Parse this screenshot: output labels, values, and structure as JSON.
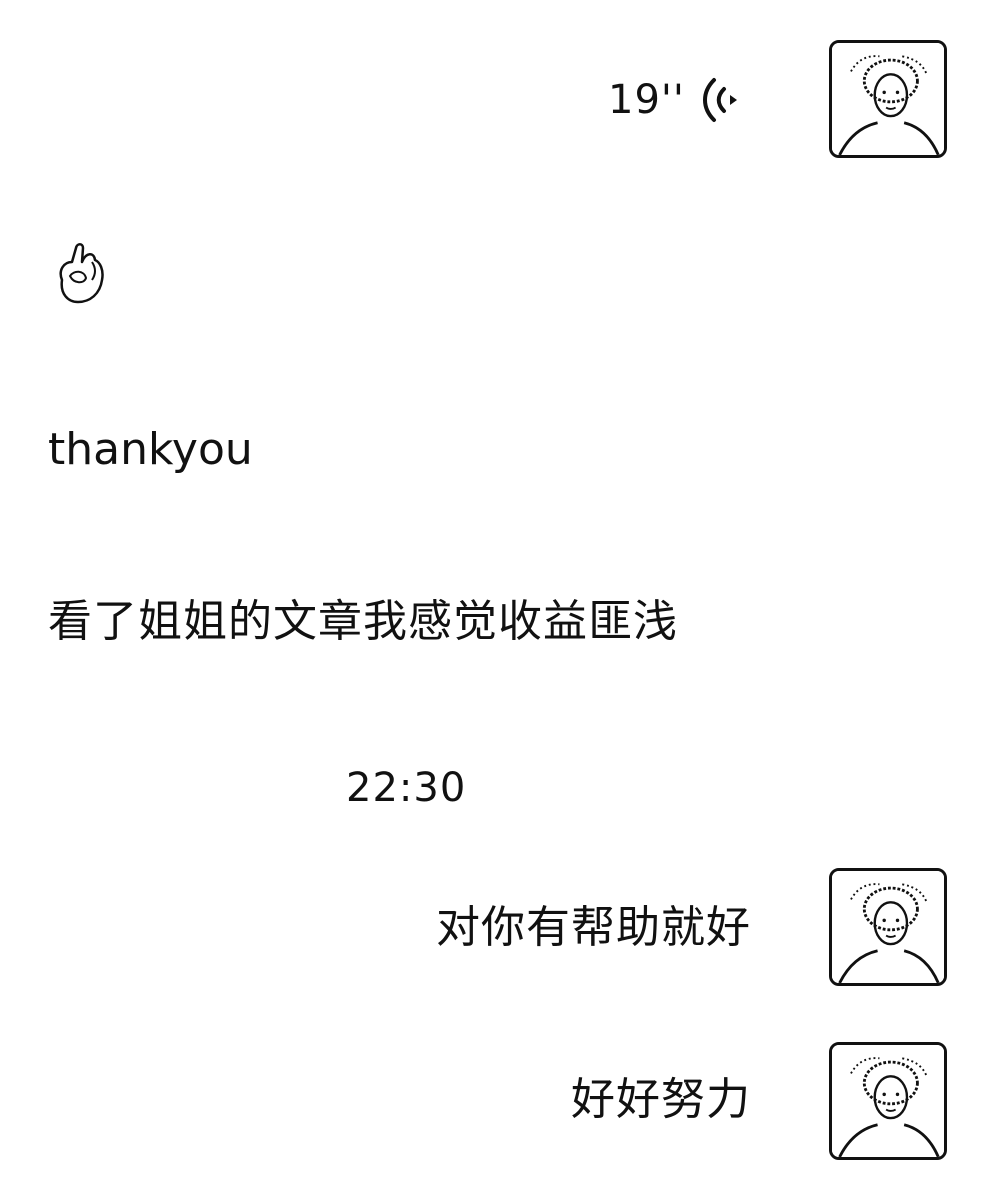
{
  "voice_message": {
    "duration": "19''",
    "icon": "voice-wave-icon"
  },
  "sticker": {
    "icon": "ok-hand-emoji-icon"
  },
  "messages_incoming": [
    {
      "text": "thankyou"
    },
    {
      "text": "看了姐姐的文章我感觉收益匪浅"
    }
  ],
  "timestamp": "22:30",
  "messages_outgoing": [
    {
      "text": "对你有帮助就好"
    },
    {
      "text": "好好努力"
    }
  ],
  "avatar": {
    "icon": "user-avatar-portrait-icon"
  }
}
